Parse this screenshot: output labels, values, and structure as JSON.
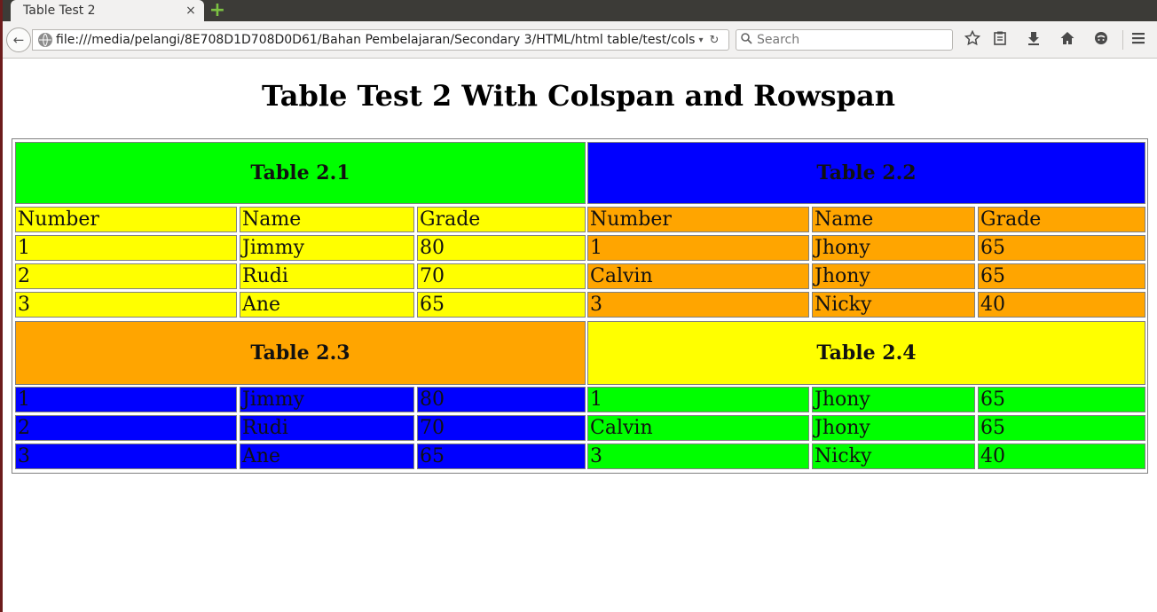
{
  "browser": {
    "tab_title": "Table Test 2",
    "tab_close": "×",
    "new_tab": "+",
    "back": "←",
    "url": "file:///media/pelangi/8E708D1D708D0D61/Bahan Pembelajaran/Secondary 3/HTML/html table/test/cols and",
    "url_dropdown": "▾",
    "reload": "↻",
    "search_placeholder": "Search",
    "icons": [
      "star-icon",
      "reading-list-icon",
      "download-icon",
      "home-icon",
      "chat-icon",
      "menu-icon"
    ]
  },
  "page": {
    "heading": "Table Test 2 With Colspan and Rowspan"
  },
  "tables": {
    "t21": {
      "title": "Table 2.1",
      "columns": [
        "Number",
        "Name",
        "Grade"
      ],
      "rows": [
        [
          "1",
          "Jimmy",
          "80"
        ],
        [
          "2",
          "Rudi",
          "70"
        ],
        [
          "3",
          "Ane",
          "65"
        ]
      ]
    },
    "t22": {
      "title": "Table 2.2",
      "columns": [
        "Number",
        "Name",
        "Grade"
      ],
      "rows": [
        [
          "1",
          "Jhony",
          "65"
        ],
        [
          "Calvin",
          "Jhony",
          "65"
        ],
        [
          "3",
          "Nicky",
          "40"
        ]
      ]
    },
    "t23": {
      "title": "Table 2.3",
      "rows": [
        [
          "1",
          "Jimmy",
          "80"
        ],
        [
          "2",
          "Rudi",
          "70"
        ],
        [
          "3",
          "Ane",
          "65"
        ]
      ]
    },
    "t24": {
      "title": "Table 2.4",
      "rows": [
        [
          "1",
          "Jhony",
          "65"
        ],
        [
          "Calvin",
          "Jhony",
          "65"
        ],
        [
          "3",
          "Nicky",
          "40"
        ]
      ]
    }
  },
  "colors": {
    "green": "#00ff00",
    "blue": "#0000ff",
    "yellow": "#ffff00",
    "orange": "#ffa500"
  }
}
